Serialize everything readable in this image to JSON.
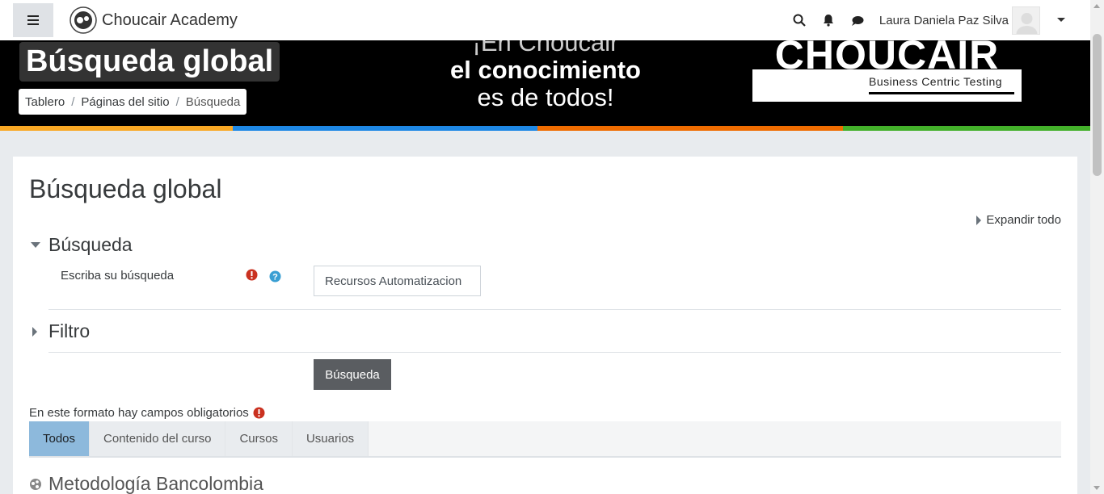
{
  "navbar": {
    "brand_name": "Choucair Academy",
    "user_name": "Laura Daniela Paz Silva",
    "icons": [
      "menu-icon",
      "search-icon",
      "bell-icon",
      "chat-icon",
      "avatar",
      "caret-down-icon"
    ]
  },
  "banner": {
    "page_title": "Búsqueda global",
    "breadcrumb": [
      "Tablero",
      "Páginas del sitio",
      "Búsqueda"
    ],
    "slogan": [
      "¡En Choucair",
      "el conocimiento",
      "es de todos!"
    ],
    "logo_word": "CHOUCAIR",
    "logo_sub": "Business Centric Testing",
    "stripe_colors": [
      "#f9a825",
      "#1e88e5",
      "#ef6c00",
      "#43b02a"
    ]
  },
  "main": {
    "title": "Búsqueda global",
    "expand_all": "Expandir todo",
    "sections": {
      "search": "Búsqueda",
      "filter": "Filtro"
    },
    "field_label": "Escriba su búsqueda",
    "search_value": "Recursos Automatizacion",
    "submit_label": "Búsqueda",
    "required_note": "En este formato hay campos obligatorios",
    "tabs": [
      "Todos",
      "Contenido del curso",
      "Cursos",
      "Usuarios"
    ],
    "active_tab": "Todos",
    "result_title": "Metodología Bancolombia"
  },
  "colors": {
    "required": "#ca3120",
    "help": "#3a9fd3",
    "active_tab": "#8db9dc",
    "button": "#5a5d61"
  }
}
